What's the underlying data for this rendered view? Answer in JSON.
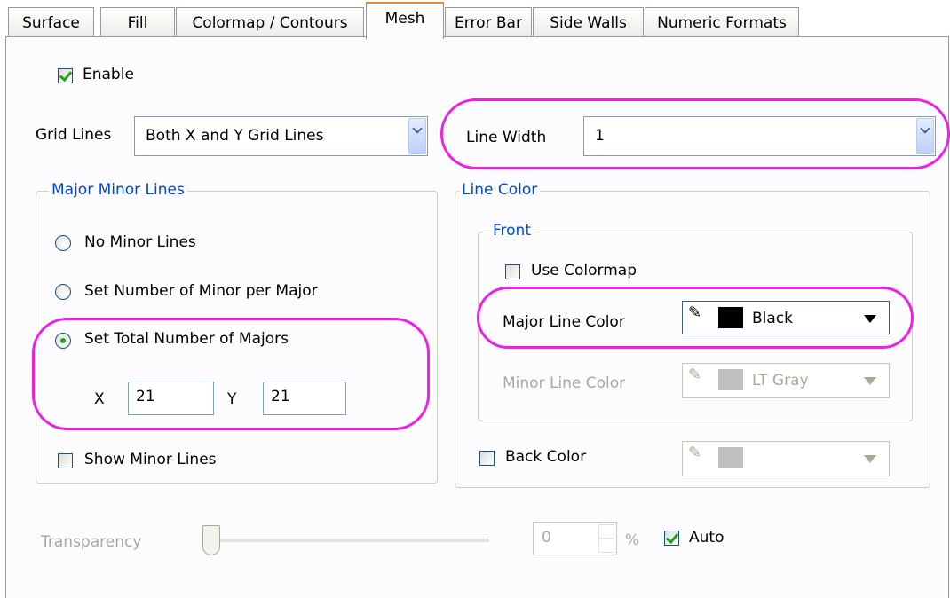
{
  "tabs": [
    {
      "label": "Surface"
    },
    {
      "label": "Fill"
    },
    {
      "label": "Colormap / Contours"
    },
    {
      "label": "Mesh"
    },
    {
      "label": "Error Bar"
    },
    {
      "label": "Side Walls"
    },
    {
      "label": "Numeric Formats"
    }
  ],
  "enable": {
    "label": "Enable",
    "checked": true
  },
  "grid_lines": {
    "label": "Grid Lines",
    "value": "Both X and Y Grid Lines"
  },
  "line_width": {
    "label": "Line Width",
    "value": "1"
  },
  "major_minor": {
    "title": "Major Minor Lines",
    "options": [
      {
        "label": "No Minor Lines",
        "selected": false
      },
      {
        "label": "Set Number of Minor per Major",
        "selected": false
      },
      {
        "label": "Set Total Number of Majors",
        "selected": true
      }
    ],
    "x_label": "X",
    "x_value": "21",
    "y_label": "Y",
    "y_value": "21",
    "show_minor": {
      "label": "Show Minor Lines",
      "checked": false
    }
  },
  "line_color": {
    "title": "Line Color",
    "front_title": "Front",
    "use_colormap": {
      "label": "Use Colormap",
      "checked": false
    },
    "major": {
      "label": "Major Line Color",
      "color_name": "Black",
      "swatch": "#000000"
    },
    "minor": {
      "label": "Minor Line Color",
      "color_name": "LT Gray",
      "swatch": "#c0c0c0",
      "enabled": false
    },
    "back": {
      "label": "Back Color",
      "checked": false,
      "swatch": "#c0c0c0",
      "enabled": false
    }
  },
  "transparency": {
    "label": "Transparency",
    "value": "0",
    "unit": "%",
    "enabled": false
  },
  "auto": {
    "label": "Auto",
    "checked": true
  },
  "colors": {
    "highlight": "#ee20e6",
    "group_title": "#0046d5",
    "active_tab_accent": "#e68b2c"
  }
}
